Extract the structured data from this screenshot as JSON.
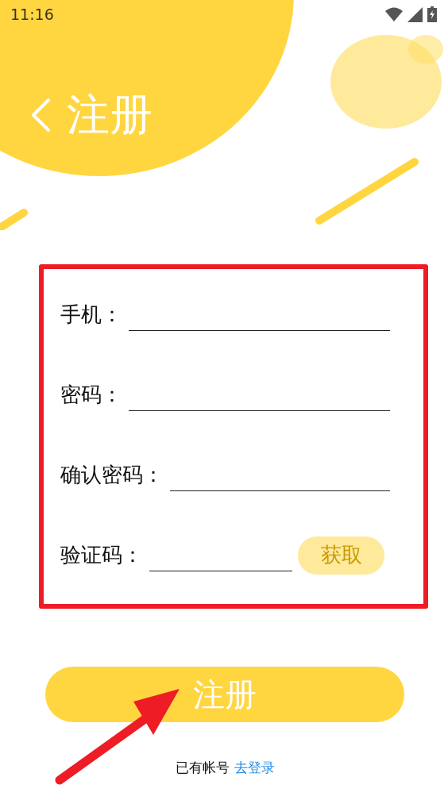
{
  "status_bar": {
    "time": "11:16"
  },
  "header": {
    "title": "注册"
  },
  "form": {
    "fields": [
      {
        "kind": "text",
        "label": "手机："
      },
      {
        "kind": "text",
        "label": "密码："
      },
      {
        "kind": "text",
        "label": "确认密码："
      },
      {
        "kind": "code",
        "label": "验证码：",
        "button": {
          "label": "获取",
          "disabled": true
        }
      }
    ]
  },
  "submit": {
    "label": "注册"
  },
  "footer": {
    "text": "已有帐号",
    "link": "去登录"
  }
}
